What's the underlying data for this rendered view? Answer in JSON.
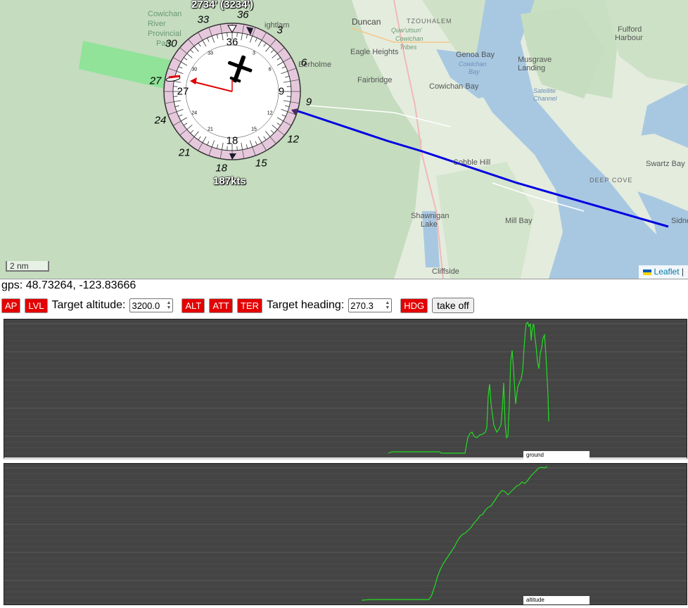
{
  "map": {
    "altitude_readout": "2734' (3234')",
    "speed_readout": "187kts",
    "scale_label": "2 nm",
    "attribution": "Leaflet",
    "labels": [
      {
        "text": "Cowichan",
        "cls": "green"
      },
      {
        "text": "River",
        "cls": "green"
      },
      {
        "text": "Provincial",
        "cls": "green"
      },
      {
        "text": "Park",
        "cls": "green"
      },
      {
        "text": "Duncan",
        "cls": ""
      },
      {
        "text": "TZOUHALEM",
        "cls": "caps"
      },
      {
        "text": "Quw'utsun'",
        "cls": "green"
      },
      {
        "text": "Cowichan",
        "cls": "green"
      },
      {
        "text": "Tribes",
        "cls": "green"
      },
      {
        "text": "Eagle Heights",
        "cls": ""
      },
      {
        "text": "Genoa Bay",
        "cls": ""
      },
      {
        "text": "Cowichan",
        "cls": "blue"
      },
      {
        "text": "Bay",
        "cls": "blue"
      },
      {
        "text": "Musgrave",
        "cls": ""
      },
      {
        "text": "Landing",
        "cls": ""
      },
      {
        "text": "Fulford",
        "cls": ""
      },
      {
        "text": "Harbour",
        "cls": ""
      },
      {
        "text": "Fairbridge",
        "cls": ""
      },
      {
        "text": "Cowichan Bay",
        "cls": ""
      },
      {
        "text": "Satellite",
        "cls": "blue"
      },
      {
        "text": "Channel",
        "cls": "blue"
      },
      {
        "text": "Cobble Hill",
        "cls": ""
      },
      {
        "text": "Swartz Bay",
        "cls": ""
      },
      {
        "text": "DEEP COVE",
        "cls": "caps"
      },
      {
        "text": "Shawnigan",
        "cls": ""
      },
      {
        "text": "Lake",
        "cls": ""
      },
      {
        "text": "Mill Bay",
        "cls": ""
      },
      {
        "text": "Sidne",
        "cls": ""
      },
      {
        "text": "Cliffside",
        "cls": ""
      },
      {
        "text": "Eerholme",
        "cls": ""
      },
      {
        "text": "ightlam",
        "cls": ""
      }
    ],
    "compass": {
      "outer_labels": [
        "33",
        "36",
        "3",
        "6",
        "9",
        "12",
        "15",
        "18",
        "21",
        "24",
        "27",
        "30"
      ],
      "inner_big": [
        "36",
        "9",
        "18",
        "27"
      ],
      "inner_small": [
        "33",
        "3",
        "6",
        "12",
        "15",
        "21",
        "24",
        "30"
      ]
    },
    "colors": {
      "route": "#0000e0",
      "heading_vector": "#e00000",
      "water": "#a6c6e0",
      "land": "#e6efe0",
      "terrain": "#c6dcc0",
      "park": "#7ee58c"
    }
  },
  "status": {
    "gps_text": "gps: 48.73264, -123.83666"
  },
  "controls": {
    "ap": "AP",
    "lvl": "LVL",
    "target_altitude_label": "Target altitude:",
    "target_altitude_value": "3200.0",
    "alt": "ALT",
    "att": "ATT",
    "ter": "TER",
    "target_heading_label": "Target heading:",
    "target_heading_value": "270.3",
    "hdg": "HDG",
    "takeoff": "take off",
    "toggle_color": "#e30000"
  },
  "graphs": {
    "ground": {
      "legend": "ground",
      "line_color": "#22dd22"
    },
    "altitude": {
      "legend": "altitude",
      "line_color": "#22dd22"
    }
  }
}
